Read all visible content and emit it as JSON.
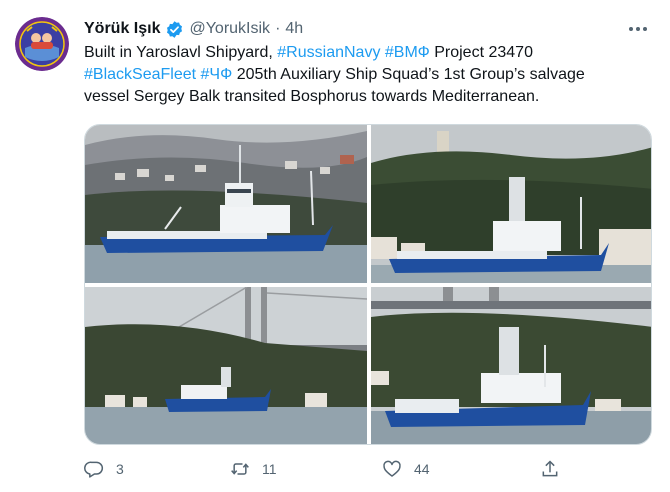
{
  "tweet": {
    "author": {
      "display_name": "Yörük Işık",
      "handle": "@YorukIsik",
      "verified_icon": "verified-badge-icon",
      "avatar_icon": "bosphorus-observer-logo",
      "avatar_color": "#3b3fa3"
    },
    "separator": "·",
    "time": "4h",
    "more_icon": "more-options-icon",
    "text": {
      "line1_prefix": "Built in Yaroslavl Shipyard, ",
      "hashtag_russian_navy": "#RussianNavy",
      "hashtag_vmf": "#ВМФ",
      "line1_suffix": " Project 23470",
      "hashtag_black_sea_fleet": "#BlackSeaFleet",
      "hashtag_chf": "#ЧФ",
      "line2_suffix": " 205th Auxiliary Ship Squad’s 1st Group’s salvage",
      "line3": "vessel Sergey Balk transited Bosphorus towards Mediterranean."
    },
    "media": {
      "photo_count": 4,
      "hull_color": "#1f4fa0",
      "water_color": "#8fa0ab"
    },
    "actions": {
      "reply_icon": "reply-icon",
      "reply_count": "3",
      "retweet_icon": "retweet-icon",
      "retweet_count": "11",
      "like_icon": "heart-icon",
      "like_count": "44",
      "share_icon": "share-icon"
    },
    "colors": {
      "link": "#1d9bf0",
      "secondary_text": "#536471",
      "primary_text": "#0f1419"
    }
  }
}
